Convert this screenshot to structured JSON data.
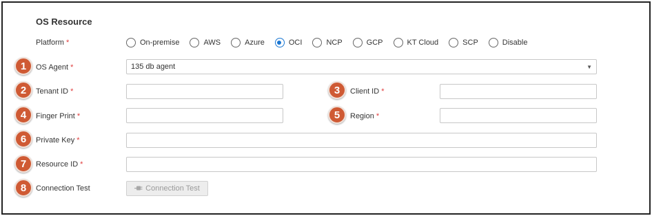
{
  "section": {
    "title": "OS Resource"
  },
  "required_mark": "*",
  "platform": {
    "label": "Platform",
    "options": [
      "On-premise",
      "AWS",
      "Azure",
      "OCI",
      "NCP",
      "GCP",
      "KT Cloud",
      "SCP",
      "Disable"
    ],
    "selected": "OCI"
  },
  "badges": [
    "1",
    "2",
    "3",
    "4",
    "5",
    "6",
    "7",
    "8"
  ],
  "os_agent": {
    "label": "OS Agent",
    "value": "135 db agent"
  },
  "tenant_id": {
    "label": "Tenant ID",
    "value": ""
  },
  "client_id": {
    "label": "Client ID",
    "value": ""
  },
  "finger_print": {
    "label": "Finger Print",
    "value": ""
  },
  "region": {
    "label": "Region",
    "value": ""
  },
  "private_key": {
    "label": "Private Key",
    "value": ""
  },
  "resource_id": {
    "label": "Resource ID",
    "value": ""
  },
  "connection_test": {
    "label": "Connection Test",
    "button_label": "Connection Test",
    "button_icon": "plug-icon"
  },
  "colors": {
    "accent": "#1976d2",
    "required": "#e03b3b",
    "badge": "#cf5a34"
  }
}
